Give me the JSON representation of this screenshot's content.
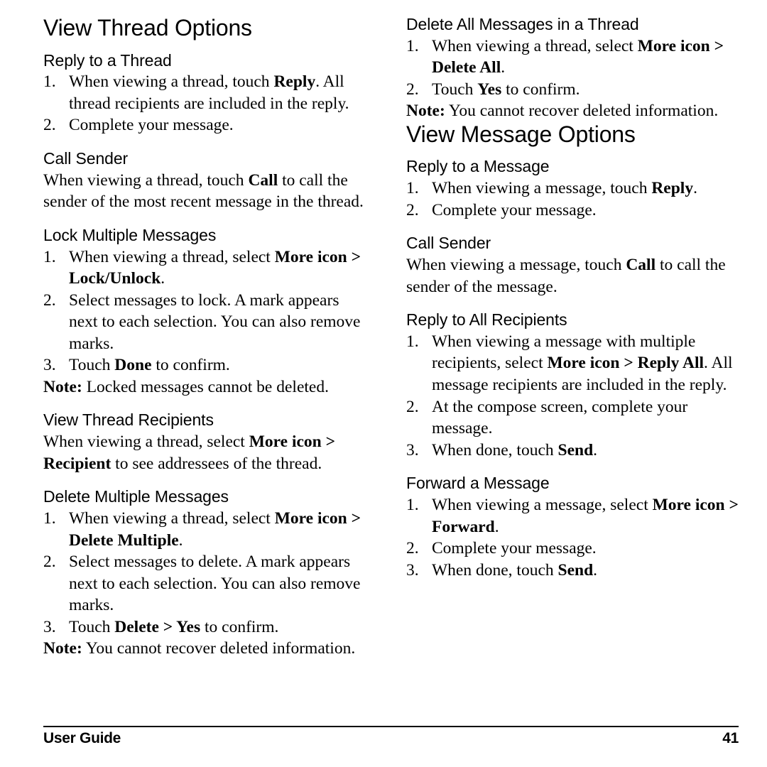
{
  "footer": {
    "label": "User Guide",
    "page_number": "41"
  },
  "left_column": {
    "title": "View Thread Options",
    "sections": [
      {
        "heading": "Reply to a Thread",
        "steps": [
          {
            "num": "1.",
            "parts": [
              {
                "t": "When viewing a thread, touch ",
                "b": false
              },
              {
                "t": "Reply",
                "b": true
              },
              {
                "t": ". All thread recipients are included in the reply.",
                "b": false
              }
            ]
          },
          {
            "num": "2.",
            "parts": [
              {
                "t": "Complete your message.",
                "b": false
              }
            ]
          }
        ]
      },
      {
        "heading": "Call Sender",
        "paragraph": [
          {
            "t": "When viewing a thread, touch ",
            "b": false
          },
          {
            "t": "Call",
            "b": true
          },
          {
            "t": " to call the sender of the most recent message in the thread.",
            "b": false
          }
        ]
      },
      {
        "heading": "Lock Multiple Messages",
        "steps": [
          {
            "num": "1.",
            "parts": [
              {
                "t": "When viewing a thread, select ",
                "b": false
              },
              {
                "t": "More icon > Lock/Unlock",
                "b": true
              },
              {
                "t": ".",
                "b": false
              }
            ]
          },
          {
            "num": "2.",
            "parts": [
              {
                "t": "Select messages to lock. A mark appears next to each selection. You can also remove marks.",
                "b": false
              }
            ]
          },
          {
            "num": "3.",
            "parts": [
              {
                "t": "Touch ",
                "b": false
              },
              {
                "t": "Done",
                "b": true
              },
              {
                "t": " to confirm.",
                "b": false
              }
            ]
          }
        ],
        "note": [
          {
            "t": "Note:",
            "b": true
          },
          {
            "t": " Locked messages cannot be deleted.",
            "b": false
          }
        ]
      },
      {
        "heading": "View Thread Recipients",
        "paragraph": [
          {
            "t": "When viewing a thread, select ",
            "b": false
          },
          {
            "t": "More icon > Recipient",
            "b": true
          },
          {
            "t": " to see addressees of the thread.",
            "b": false
          }
        ]
      },
      {
        "heading": "Delete Multiple Messages",
        "steps": [
          {
            "num": "1.",
            "parts": [
              {
                "t": "When viewing a thread, select ",
                "b": false
              },
              {
                "t": "More icon > Delete Multiple",
                "b": true
              },
              {
                "t": ".",
                "b": false
              }
            ]
          },
          {
            "num": "2.",
            "parts": [
              {
                "t": "Select messages to delete. A mark appears next to each selection. You can also remove marks.",
                "b": false
              }
            ]
          },
          {
            "num": "3.",
            "parts": [
              {
                "t": "Touch ",
                "b": false
              },
              {
                "t": "Delete > Yes",
                "b": true
              },
              {
                "t": " to confirm.",
                "b": false
              }
            ]
          }
        ],
        "note": [
          {
            "t": "Note:",
            "b": true
          },
          {
            "t": " You cannot recover deleted information.",
            "b": false
          }
        ]
      }
    ]
  },
  "right_column": {
    "title": "View Message Options",
    "top_section": {
      "heading": "Delete All Messages in a Thread",
      "steps": [
        {
          "num": "1.",
          "parts": [
            {
              "t": "When viewing a thread, select ",
              "b": false
            },
            {
              "t": "More icon > Delete All",
              "b": true
            },
            {
              "t": ".",
              "b": false
            }
          ]
        },
        {
          "num": "2.",
          "parts": [
            {
              "t": "Touch ",
              "b": false
            },
            {
              "t": "Yes",
              "b": true
            },
            {
              "t": " to confirm.",
              "b": false
            }
          ]
        }
      ],
      "note": [
        {
          "t": "Note:",
          "b": true
        },
        {
          "t": " You cannot recover deleted information.",
          "b": false
        }
      ]
    },
    "sections": [
      {
        "heading": "Reply to a Message",
        "steps": [
          {
            "num": "1.",
            "parts": [
              {
                "t": "When viewing a message, touch ",
                "b": false
              },
              {
                "t": "Reply",
                "b": true
              },
              {
                "t": ".",
                "b": false
              }
            ]
          },
          {
            "num": "2.",
            "parts": [
              {
                "t": "Complete your message.",
                "b": false
              }
            ]
          }
        ]
      },
      {
        "heading": "Call Sender",
        "paragraph": [
          {
            "t": "When viewing a message, touch ",
            "b": false
          },
          {
            "t": "Call",
            "b": true
          },
          {
            "t": " to call the sender of the message.",
            "b": false
          }
        ]
      },
      {
        "heading": "Reply to All Recipients",
        "steps": [
          {
            "num": "1.",
            "parts": [
              {
                "t": "When viewing a message with multiple recipients, select ",
                "b": false
              },
              {
                "t": "More icon > Reply All",
                "b": true
              },
              {
                "t": ". All message recipients are included in the reply.",
                "b": false
              }
            ]
          },
          {
            "num": "2.",
            "parts": [
              {
                "t": "At the compose screen, complete your message.",
                "b": false
              }
            ]
          },
          {
            "num": "3.",
            "parts": [
              {
                "t": "When done, touch ",
                "b": false
              },
              {
                "t": "Send",
                "b": true
              },
              {
                "t": ".",
                "b": false
              }
            ]
          }
        ]
      },
      {
        "heading": "Forward a Message",
        "steps": [
          {
            "num": "1.",
            "parts": [
              {
                "t": "When viewing a message, select ",
                "b": false
              },
              {
                "t": "More icon > Forward",
                "b": true
              },
              {
                "t": ".",
                "b": false
              }
            ]
          },
          {
            "num": "2.",
            "parts": [
              {
                "t": "Complete your message.",
                "b": false
              }
            ]
          },
          {
            "num": "3.",
            "parts": [
              {
                "t": "When done, touch ",
                "b": false
              },
              {
                "t": "Send",
                "b": true
              },
              {
                "t": ".",
                "b": false
              }
            ]
          }
        ]
      }
    ]
  }
}
